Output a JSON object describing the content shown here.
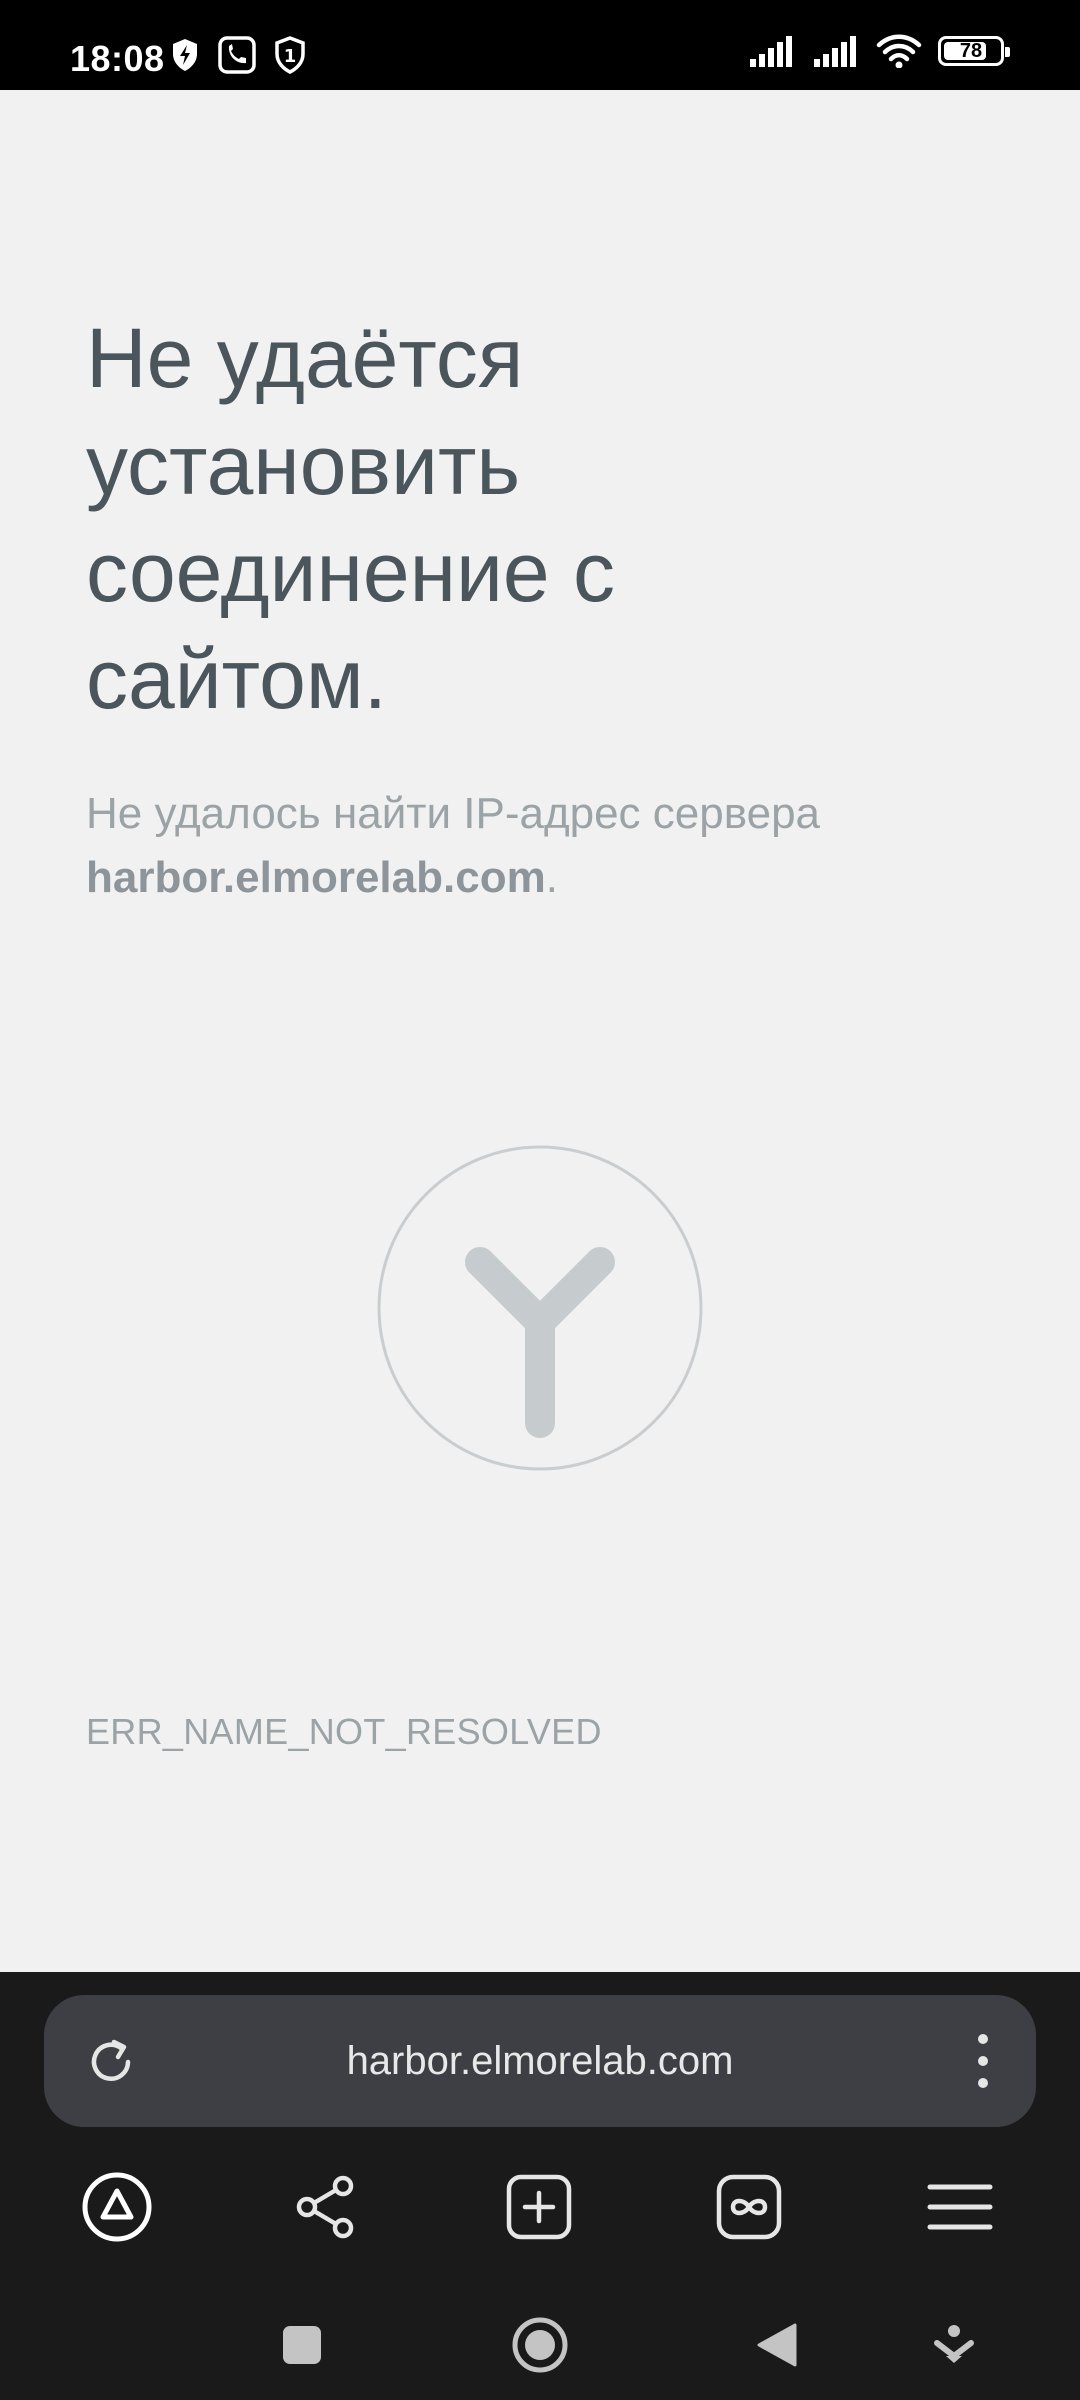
{
  "status_bar": {
    "time": "18:08",
    "battery_level": "78",
    "icons": [
      "shield-bolt-icon",
      "phone-call-icon",
      "one-shield-icon",
      "signal-icon",
      "signal-icon",
      "wifi-icon",
      "battery-icon"
    ]
  },
  "error": {
    "title": "Не удаётся установить соединение с сайтом.",
    "description_prefix": "Не удалось найти IP-адрес сервера ",
    "host": "harbor.elmorelab.com",
    "description_suffix": ".",
    "code": "ERR_NAME_NOT_RESOLVED"
  },
  "omnibox": {
    "url": "harbor.elmorelab.com",
    "icons": [
      "reload-icon",
      "more-vert-icon"
    ]
  },
  "toolbar": {
    "icons": [
      "alice-icon",
      "share-icon",
      "new-tab-icon",
      "tabs-icon",
      "menu-icon"
    ]
  },
  "nav_bar": {
    "icons": [
      "recents-square-icon",
      "home-circle-icon",
      "back-triangle-icon",
      "drawer-down-icon"
    ]
  },
  "colors": {
    "page_background": "#f1f1f1",
    "title_color": "#4b555c",
    "muted_text": "#9ca3a7",
    "browser_chrome": "#1a1a1a",
    "omnibox": "#3e3f44"
  }
}
